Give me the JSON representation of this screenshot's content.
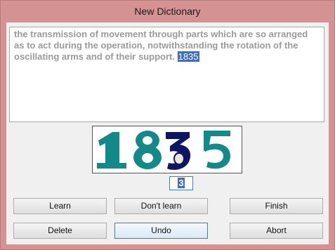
{
  "window": {
    "title": "New Dictionary"
  },
  "text": {
    "body": "the transmission of movement through parts which are so arranged as to act during the operation, notwithstanding the rotation of the oscillating arms and of their support.",
    "selected": "1835"
  },
  "captcha": {
    "digits": [
      "1",
      "8",
      "3",
      "5"
    ],
    "colors": {
      "teal": "#14898a",
      "navy": "#0c1662",
      "cream": "#e9e6d6"
    }
  },
  "entry": {
    "value": "3"
  },
  "buttons": {
    "learn": "Learn",
    "dont_learn": "Don't learn",
    "finish": "Finish",
    "delete": "Delete",
    "undo": "Undo",
    "abort": "Abort"
  },
  "colors": {
    "title_bar": "#d59292",
    "selection": "#3b6fc5"
  }
}
